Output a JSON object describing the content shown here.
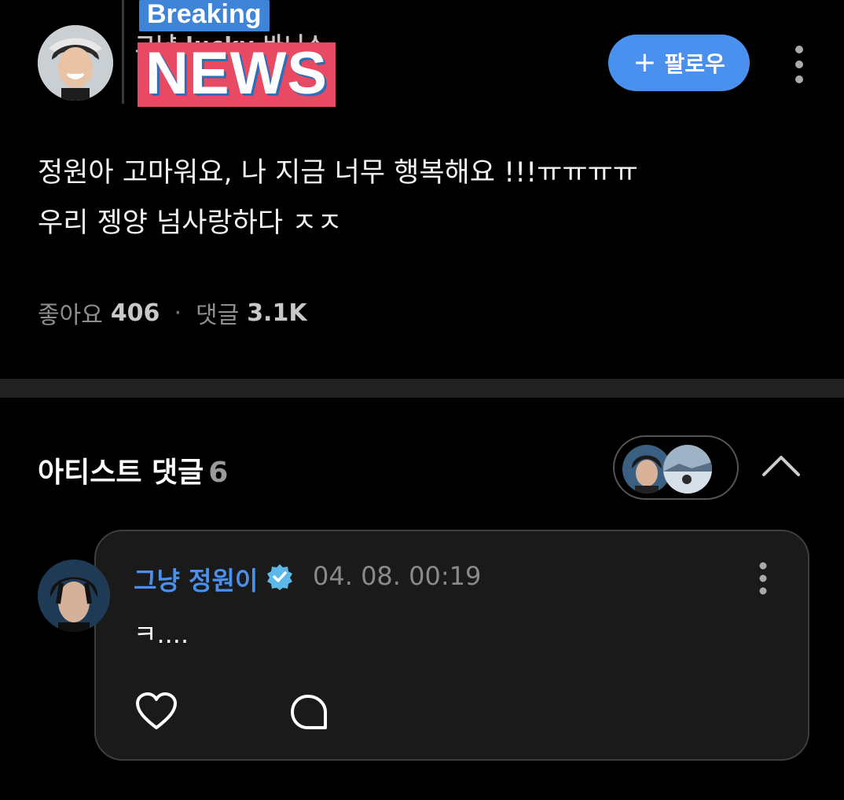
{
  "header": {
    "hidden_username": "그냥 lucky 바니스",
    "overlay_top": "Breaking",
    "overlay_main": "NEWS",
    "follow_label": "팔로우"
  },
  "post": {
    "line1": "정원아 고마워요, 나 지금 너무 행복해요 !!!ㅠㅠㅠㅠ",
    "line2": "우리 젱양 넘사랑하다 ㅈㅈ",
    "likes_label": "좋아요",
    "likes_count": "406",
    "separator": "·",
    "comments_label": "댓글",
    "comments_count": "3.1K"
  },
  "artist_section": {
    "title": "아티스트 댓글",
    "count": "6"
  },
  "comment": {
    "author": "그냥 정원이",
    "timestamp": "04. 08. 00:19",
    "text": "ㅋ...."
  },
  "colors": {
    "accent": "#4a90ee",
    "background": "#000000",
    "card": "#1a1a1a",
    "breaking_bg": "#3f84d6",
    "news_bg": "#e84a63",
    "verified": "#5cb8e6"
  },
  "icons": [
    "plus-icon",
    "more-vertical-icon",
    "chevron-up-icon",
    "verified-badge-icon",
    "heart-icon",
    "reply-bubble-icon"
  ]
}
